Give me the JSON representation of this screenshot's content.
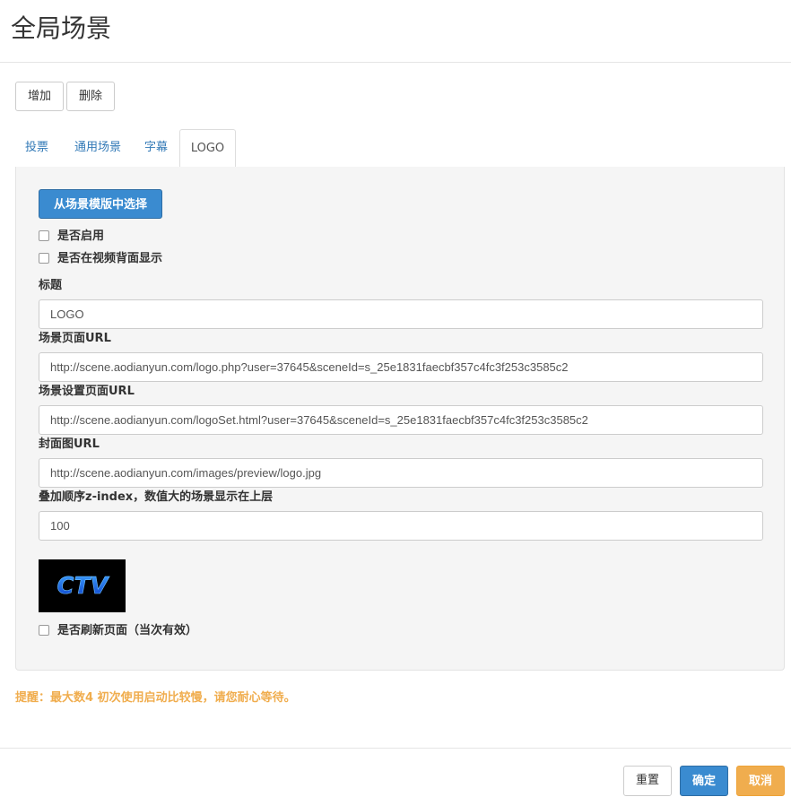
{
  "page": {
    "title": "全局场景"
  },
  "toolbar": {
    "add_label": "增加",
    "delete_label": "删除"
  },
  "tabs": [
    {
      "label": "投票",
      "active": false
    },
    {
      "label": "通用场景",
      "active": false
    },
    {
      "label": "字幕",
      "active": false
    },
    {
      "label": "LOGO",
      "active": true
    }
  ],
  "form": {
    "template_button": "从场景模版中选择",
    "enable_label": "是否启用",
    "enable_checked": false,
    "behind_video_label": "是否在视频背面显示",
    "behind_video_checked": false,
    "title_label": "标题",
    "title_value": "LOGO",
    "scene_url_label": "场景页面URL",
    "scene_url_value": "http://scene.aodianyun.com/logo.php?user=37645&sceneId=s_25e1831faecbf357c4fc3f253c3585c2",
    "settings_url_label": "场景设置页面URL",
    "settings_url_value": "http://scene.aodianyun.com/logoSet.html?user=37645&sceneId=s_25e1831faecbf357c4fc3f253c3585c2",
    "cover_url_label": "封面图URL",
    "cover_url_value": "http://scene.aodianyun.com/images/preview/logo.jpg",
    "zindex_label": "叠加顺序z-index，数值大的场景显示在上层",
    "zindex_value": "100",
    "preview_logo_text": "CTV",
    "refresh_label": "是否刷新页面（当次有效）",
    "refresh_checked": false
  },
  "notice": "提醒：最大数4 初次使用启动比较慢，请您耐心等待。",
  "footer": {
    "reset_label": "重置",
    "ok_label": "确定",
    "cancel_label": "取消"
  },
  "colors": {
    "primary": "#3a8bd0",
    "warning": "#f0ad4e",
    "link": "#337ab7",
    "panel_bg": "#f5f5f5"
  }
}
